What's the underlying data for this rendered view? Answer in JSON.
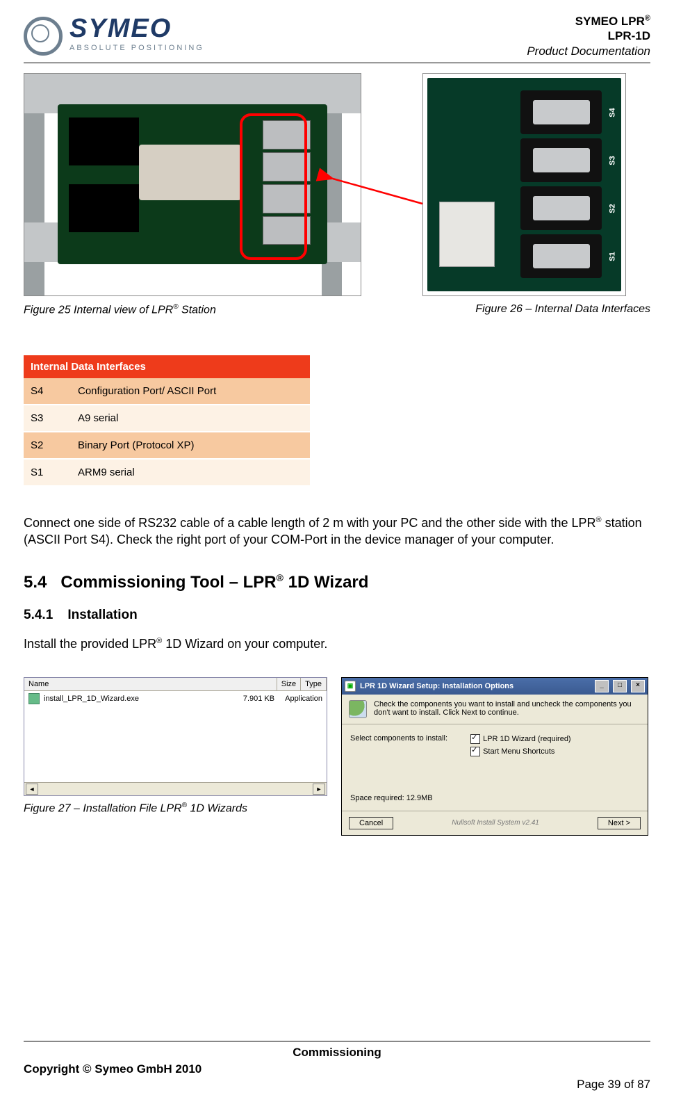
{
  "header": {
    "logo_main": "SYMEO",
    "logo_sub": "ABSOLUTE POSITIONING",
    "doc_line1_a": "SYMEO LPR",
    "doc_line1_sup": "®",
    "doc_line2": "LPR-1D",
    "doc_line3": "Product Documentation"
  },
  "figures": {
    "f25_a": "Figure 25 Internal view of LPR",
    "f25_sup": "®",
    "f25_b": " Station",
    "f26": "Figure 26 – Internal Data Interfaces",
    "f27_a": "Figure  27 – Installation File LPR",
    "f27_sup": "®",
    "f27_b": " 1D Wizards"
  },
  "ports": {
    "s1": "S1",
    "s2": "S2",
    "s3": "S3",
    "s4": "S4"
  },
  "iface_table": {
    "title": "Internal Data Interfaces",
    "rows": [
      {
        "k": "S4",
        "v": "Configuration Port/ ASCII Port"
      },
      {
        "k": "S3",
        "v": "A9 serial"
      },
      {
        "k": "S2",
        "v": "Binary Port (Protocol XP)"
      },
      {
        "k": "S1",
        "v": "ARM9 serial"
      }
    ]
  },
  "paragraph1_a": "Connect one side of RS232 cable of a cable length of 2 m with your PC and the other side with the LPR",
  "paragraph1_sup": "®",
  "paragraph1_b": " station (ASCII Port S4). Check the right port of your COM-Port in the device manager of your computer.",
  "section": {
    "num": "5.4",
    "title_a": "Commissioning Tool – LPR",
    "title_sup": "®",
    "title_b": " 1D Wizard",
    "sub_num": "5.4.1",
    "sub_title": "Installation"
  },
  "paragraph2_a": "Install the provided LPR",
  "paragraph2_sup": "®",
  "paragraph2_b": " 1D Wizard on your computer.",
  "explorer": {
    "col_name": "Name",
    "col_size": "Size",
    "col_type": "Type",
    "file_name": "install_LPR_1D_Wizard.exe",
    "file_size": "7.901 KB",
    "file_type": "Application"
  },
  "wizard": {
    "title": "LPR 1D Wizard Setup: Installation Options",
    "instr": "Check the components you want to install and uncheck the components you don't want to install. Click Next to continue.",
    "select_label": "Select components to install:",
    "opt1": "LPR 1D Wizard (required)",
    "opt2": "Start Menu Shortcuts",
    "space": "Space required: 12.9MB",
    "cancel": "Cancel",
    "nullsoft": "Nullsoft Install System v2.41",
    "next": "Next >"
  },
  "footer": {
    "center": "Commissioning",
    "left": "Copyright © Symeo GmbH 2010",
    "right": "Page 39 of 87"
  }
}
